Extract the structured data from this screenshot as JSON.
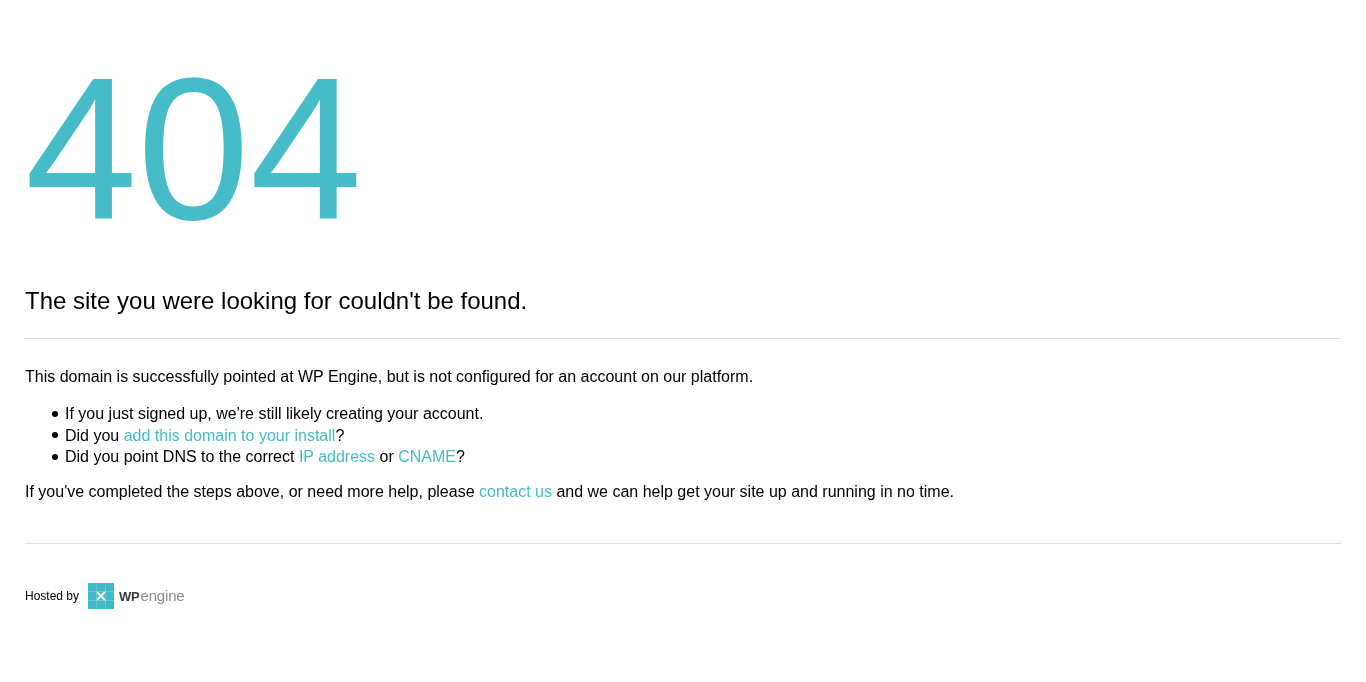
{
  "error_code": "404",
  "heading": "The site you were looking for couldn't be found.",
  "intro": "This domain is successfully pointed at WP Engine, but is not configured for an account on our platform.",
  "checklist": [
    {
      "parts": [
        {
          "kind": "text",
          "text": "If you just signed up, we're still likely creating your account."
        }
      ]
    },
    {
      "parts": [
        {
          "kind": "text",
          "text": "Did you "
        },
        {
          "kind": "link",
          "text": "add this domain to your install"
        },
        {
          "kind": "text",
          "text": "?"
        }
      ]
    },
    {
      "parts": [
        {
          "kind": "text",
          "text": "Did you point DNS to the correct "
        },
        {
          "kind": "link",
          "text": "IP address"
        },
        {
          "kind": "text",
          "text": " or "
        },
        {
          "kind": "link",
          "text": "CNAME"
        },
        {
          "kind": "text",
          "text": "?"
        }
      ]
    }
  ],
  "help": {
    "parts": [
      {
        "kind": "text",
        "text": "If you've completed the steps above, or need more help, please "
      },
      {
        "kind": "link",
        "text": "contact us"
      },
      {
        "kind": "text",
        "text": " and we can help get your site up and running in no time."
      }
    ]
  },
  "footer": {
    "hosted_by": "Hosted by",
    "logo_text": "**WP**engine"
  }
}
